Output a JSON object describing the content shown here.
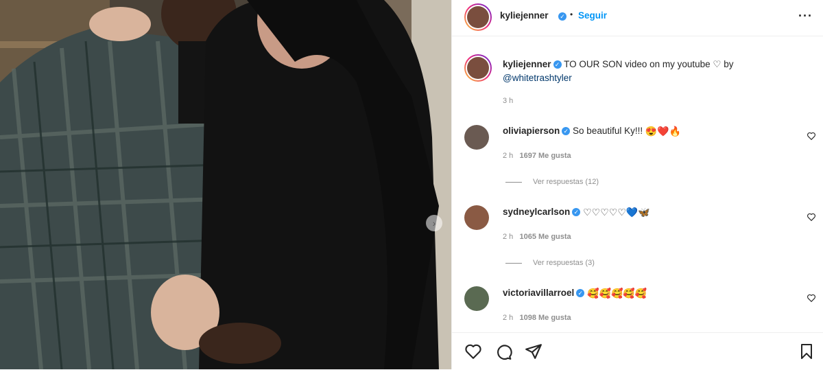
{
  "post": {
    "username": "kyliejenner",
    "separator": "•",
    "follow_label": "Seguir",
    "more_label": "···"
  },
  "caption": {
    "username": "kyliejenner",
    "text": "TO OUR SON video on my youtube ♡ by",
    "mention": "@whitetrashtyler",
    "time": "3 h"
  },
  "comments": [
    {
      "username": "oliviapierson",
      "text": "So beautiful Ky!!!",
      "emojis": [
        "😍",
        "❤️",
        "🔥"
      ],
      "time": "2 h",
      "likes": "1697 Me gusta",
      "replies": "Ver respuestas (12)"
    },
    {
      "username": "sydneylcarlson",
      "text": "",
      "emojis": [
        "♡",
        "♡",
        "♡",
        "♡",
        "♡",
        "💙",
        "🦋"
      ],
      "time": "2 h",
      "likes": "1065 Me gusta",
      "replies": "Ver respuestas (3)"
    },
    {
      "username": "victoriavillarroel",
      "text": "",
      "emojis": [
        "🥰",
        "🥰",
        "🥰",
        "🥰",
        "🥰"
      ],
      "time": "2 h",
      "likes": "1098 Me gusta",
      "replies": ""
    }
  ],
  "colors": {
    "accent": "#0095f6",
    "verified": "#3897f0",
    "text": "#262626",
    "muted": "#8e8e8e"
  },
  "icons": {
    "like": "heart-outline-icon",
    "comment": "comment-bubble-icon",
    "share": "paper-plane-icon",
    "save": "bookmark-icon",
    "verified": "verified-badge-icon",
    "carousel": "chevron-right-icon"
  }
}
